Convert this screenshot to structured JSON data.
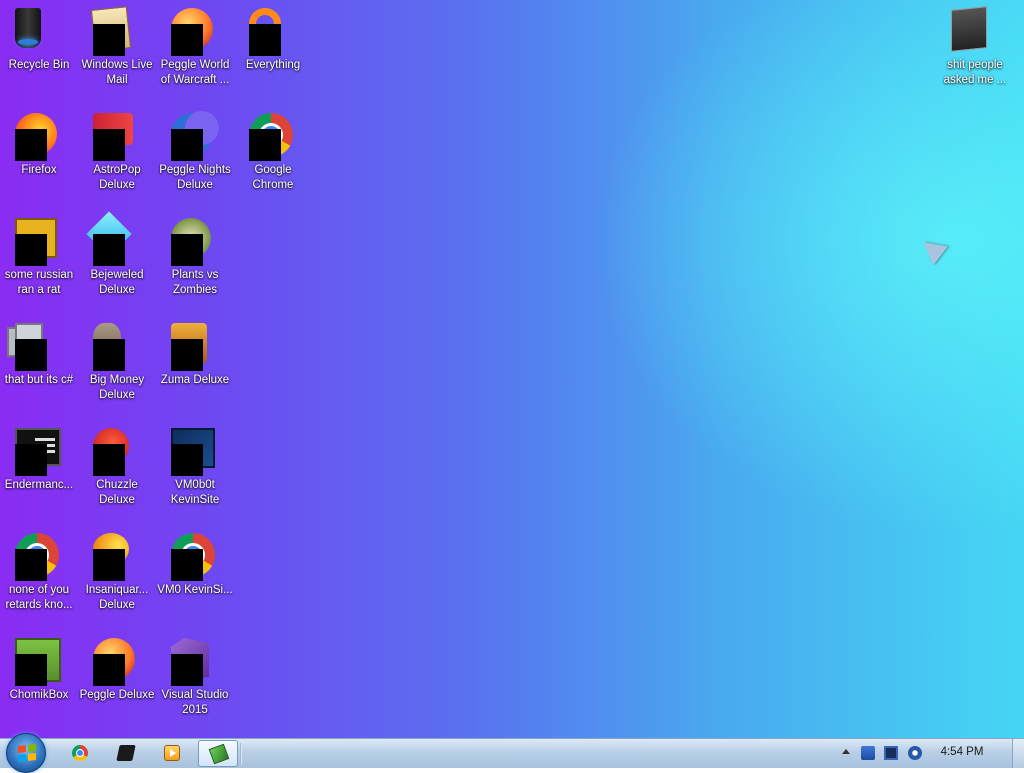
{
  "desktop": {
    "icons": [
      {
        "label": "Recycle Bin",
        "icon": "recycle-bin-icon"
      },
      {
        "label": "Windows Live Mail",
        "icon": "mail-icon"
      },
      {
        "label": "Peggle World of Warcraft ...",
        "icon": "peggle-icon"
      },
      {
        "label": "Everything",
        "icon": "search-ring-icon"
      },
      {
        "label": "Firefox",
        "icon": "firefox-icon"
      },
      {
        "label": "AstroPop Deluxe",
        "icon": "astropop-icon"
      },
      {
        "label": "Peggle Nights Deluxe",
        "icon": "moon-icon"
      },
      {
        "label": "Google Chrome",
        "icon": "chrome-icon"
      },
      {
        "label": "some russian ran a rat",
        "icon": "document-icon"
      },
      {
        "label": "Bejeweled Deluxe",
        "icon": "gem-icon"
      },
      {
        "label": "Plants vs Zombies",
        "icon": "plant-icon"
      },
      {
        "label": "that but its c#",
        "icon": "stacked-windows-icon"
      },
      {
        "label": "Big Money Deluxe",
        "icon": "money-sack-icon"
      },
      {
        "label": "Zuma Deluxe",
        "icon": "zuma-icon"
      },
      {
        "label": "Endermanc...",
        "icon": "terminal-icon"
      },
      {
        "label": "Chuzzle Deluxe",
        "icon": "chuzzle-icon"
      },
      {
        "label": "VM0b0t KevinSite",
        "icon": "website-icon"
      },
      {
        "label": "none of you retards kno...",
        "icon": "chrome-icon"
      },
      {
        "label": "Insaniquar... Deluxe",
        "icon": "fish-icon"
      },
      {
        "label": "VM0 KevinSi...",
        "icon": "chrome-icon"
      },
      {
        "label": "ChomikBox",
        "icon": "chomikbox-icon"
      },
      {
        "label": "Peggle Deluxe",
        "icon": "peggle-icon"
      },
      {
        "label": "Visual Studio 2015",
        "icon": "visual-studio-icon"
      },
      {
        "label": "shit people asked me ...",
        "icon": "folder-icon"
      }
    ]
  },
  "taskbar": {
    "start_icon": "windows-start-icon",
    "pinned": [
      {
        "name": "chrome",
        "icon": "chrome-icon"
      },
      {
        "name": "app",
        "icon": "black-app-icon"
      },
      {
        "name": "media",
        "icon": "media-player-icon"
      },
      {
        "name": "active-app",
        "icon": "green-app-icon"
      }
    ],
    "tray": {
      "clock": "4:54 PM"
    }
  },
  "colors": {
    "desktop_left": "#8a2cf2",
    "desktop_right": "#45d6f4",
    "taskbar": "#b9cfe6"
  }
}
